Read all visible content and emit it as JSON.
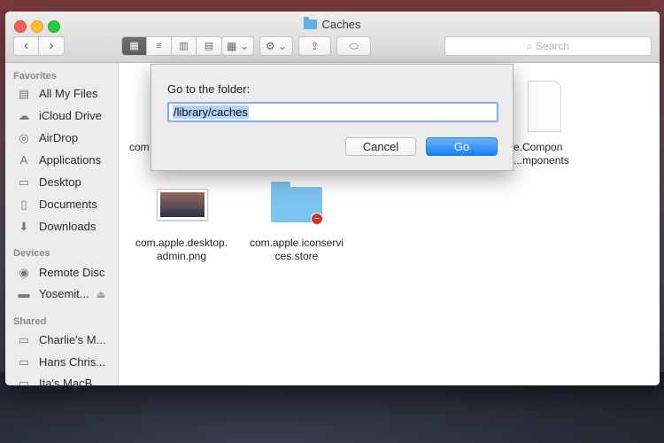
{
  "window": {
    "title": "Caches",
    "search_placeholder": "Search"
  },
  "toolbar": {
    "back_glyph": "‹",
    "forward_glyph": "›",
    "view_glyphs": [
      "▦",
      "≡",
      "▥",
      "▤"
    ],
    "arrange_glyph": "▦ ⌄",
    "action_glyph": "⚙ ⌄",
    "share_glyph": "⇪",
    "tag_glyph": "⬭"
  },
  "sidebar": {
    "favorites_header": "Favorites",
    "favorites": [
      {
        "label": "All My Files",
        "icon": "all-files-icon",
        "glyph": "▤"
      },
      {
        "label": "iCloud Drive",
        "icon": "cloud-icon",
        "glyph": "☁"
      },
      {
        "label": "AirDrop",
        "icon": "airdrop-icon",
        "glyph": "◎"
      },
      {
        "label": "Applications",
        "icon": "applications-icon",
        "glyph": "A"
      },
      {
        "label": "Desktop",
        "icon": "desktop-icon",
        "glyph": "▭"
      },
      {
        "label": "Documents",
        "icon": "documents-icon",
        "glyph": "▯"
      },
      {
        "label": "Downloads",
        "icon": "downloads-icon",
        "glyph": "⬇"
      }
    ],
    "devices_header": "Devices",
    "devices": [
      {
        "label": "Remote Disc",
        "icon": "disc-icon",
        "glyph": "◉"
      },
      {
        "label": "Yosemit...",
        "icon": "drive-icon",
        "glyph": "▬",
        "eject_glyph": "⏏"
      }
    ],
    "shared_header": "Shared",
    "shared": [
      {
        "label": "Charlie's M...",
        "icon": "computer-icon",
        "glyph": "▭"
      },
      {
        "label": "Hans Chris...",
        "icon": "computer-icon",
        "glyph": "▭"
      },
      {
        "label": "Ita's MacB...",
        "icon": "computer-icon",
        "glyph": "▭"
      }
    ]
  },
  "files": [
    {
      "line1": "com",
      "line2": ""
    },
    {
      "line1": "e.Compon",
      "line2": "...mponents"
    },
    {
      "line1": "com.apple.desktop.",
      "line2": "admin.png"
    },
    {
      "line1": "com.apple.iconservi",
      "line2": "ces.store"
    }
  ],
  "dialog": {
    "label": "Go to the folder:",
    "value": "/library/caches",
    "cancel_label": "Cancel",
    "go_label": "Go"
  },
  "colors": {
    "accent": "#1a82fb",
    "folder": "#7cc4f0",
    "no_access_badge": "#d8302a"
  }
}
